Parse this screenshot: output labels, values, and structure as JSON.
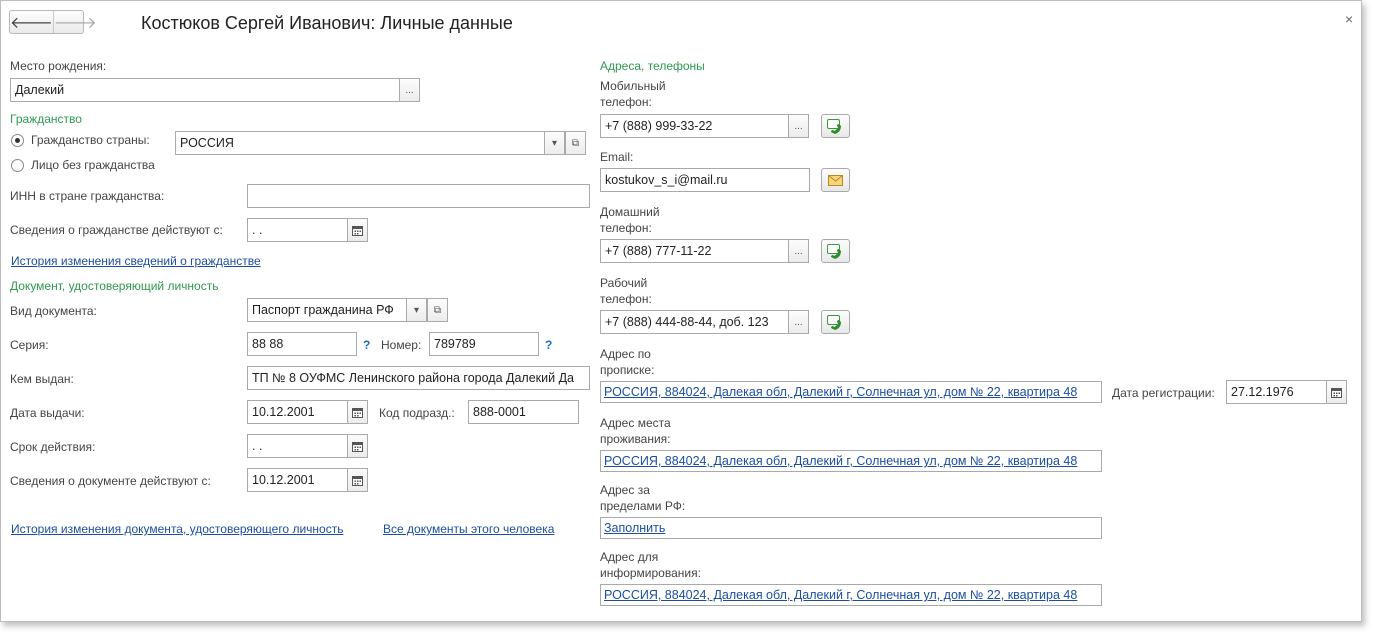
{
  "header": {
    "title": "Костюков Сергей Иванович: Личные данные",
    "back_glyph": "🡐",
    "forward_glyph": "🡒",
    "close_glyph": "×"
  },
  "left": {
    "birthplace_label": "Место рождения:",
    "birthplace_value": "Далекий",
    "citizenship_section": "Гражданство",
    "citizenship_country_label": "Гражданство страны:",
    "citizenship_country_value": "РОССИЯ",
    "stateless_label": "Лицо без гражданства",
    "inn_label": "ИНН в стране гражданства:",
    "inn_value": "",
    "citizenship_valid_label": "Сведения о гражданстве действуют с:",
    "citizenship_valid_value": "  .  .",
    "citizenship_history_link": "История изменения сведений о гражданстве",
    "doc_section": "Документ, удостоверяющий личность",
    "doc_type_label": "Вид документа:",
    "doc_type_value": "Паспорт гражданина РФ",
    "series_label": "Серия:",
    "series_value": "88 88",
    "number_label": "Номер:",
    "number_value": "789789",
    "help_glyph": "?",
    "issued_by_label": "Кем выдан:",
    "issued_by_value": "ТП № 8 ОУФМС Ленинского района города Далекий Да",
    "issue_date_label": "Дата выдачи:",
    "issue_date_value": "10.12.2001",
    "dept_code_label": "Код подразд.:",
    "dept_code_value": "888-0001",
    "expiry_label": "Срок действия:",
    "expiry_value": "  .  .",
    "doc_valid_label": "Сведения о документе действуют с:",
    "doc_valid_value": "10.12.2001",
    "doc_history_link": "История изменения документа, удостоверяющего личность",
    "all_docs_link": "Все документы этого человека"
  },
  "right": {
    "section": "Адреса, телефоны",
    "mobile_label_1": "Мобильный",
    "mobile_label_2": "телефон:",
    "mobile_value": "+7 (888) 999-33-22",
    "email_label": "Email:",
    "email_value": "kostukov_s_i@mail.ru",
    "home_label_1": "Домашний",
    "home_label_2": "телефон:",
    "home_value": "+7 (888) 777-11-22",
    "work_label_1": "Рабочий",
    "work_label_2": "телефон:",
    "work_value": "+7 (888) 444-88-44, доб. 123",
    "reg_addr_label_1": "Адрес по",
    "reg_addr_label_2": "прописке:",
    "reg_addr_value": "РОССИЯ, 884024, Далекая обл, Далекий г, Солнечная ул, дом № 22, квартира 48",
    "reg_date_label": "Дата регистрации:",
    "reg_date_value": "27.12.1976",
    "live_addr_label_1": "Адрес места",
    "live_addr_label_2": "проживания:",
    "live_addr_value": "РОССИЯ, 884024, Далекая обл, Далекий г, Солнечная ул, дом № 22, квартира 48",
    "abroad_addr_label_1": "Адрес за",
    "abroad_addr_label_2": "пределами РФ:",
    "abroad_addr_value": "Заполнить",
    "info_addr_label_1": "Адрес для",
    "info_addr_label_2": "информирования:",
    "info_addr_value": "РОССИЯ, 884024, Далекая обл, Далекий г, Солнечная ул, дом № 22, квартира 48"
  },
  "glyphs": {
    "ellipsis": "...",
    "dropdown": "▾",
    "open": "⧉"
  },
  "colors": {
    "section_green": "#2e9a4e",
    "link_blue": "#1c4ea0"
  }
}
